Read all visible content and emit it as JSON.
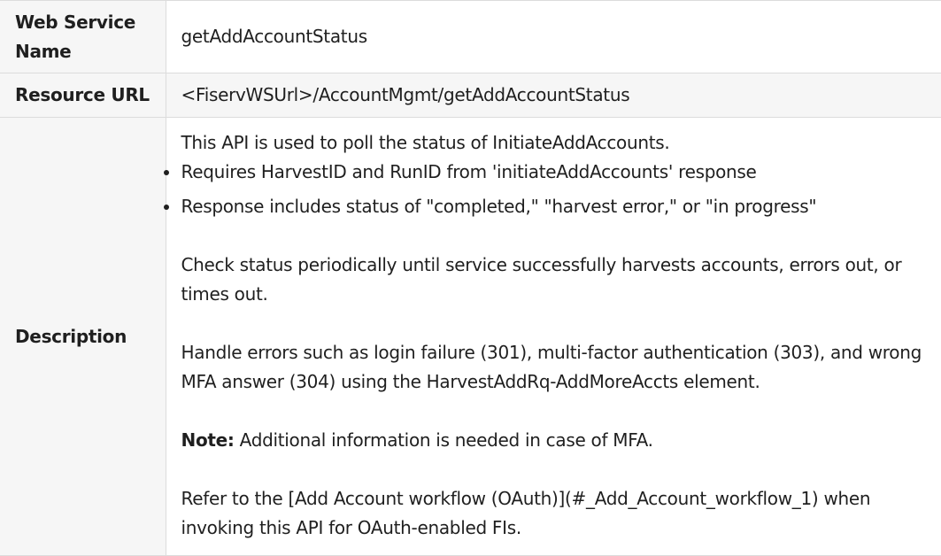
{
  "rows": {
    "name": {
      "label": "Web Service Name",
      "value": "getAddAccountStatus"
    },
    "url": {
      "label": "Resource URL",
      "value": "<FiservWSUrl>/AccountMgmt/getAddAccountStatus"
    },
    "description": {
      "label": "Description",
      "intro": "This API is used to poll the status of InitiateAddAccounts.",
      "bullets": [
        "Requires HarvestID and RunID from 'initiateAddAccounts' response",
        "Response includes status of \"completed,\" \"harvest error,\" or \"in progress\""
      ],
      "para1": "Check status periodically until service successfully harvests accounts, errors out, or times out.",
      "para2": "Handle errors such as login failure (301), multi-factor authentication (303), and wrong MFA answer (304) using the HarvestAddRq-AddMoreAccts element.",
      "note_label": "Note:",
      "note_text": " Additional information is needed in case of MFA.",
      "para3": "Refer to the [Add Account workflow (OAuth)](#_Add_Account_workflow_1) when invoking this API for OAuth-enabled FIs."
    }
  }
}
